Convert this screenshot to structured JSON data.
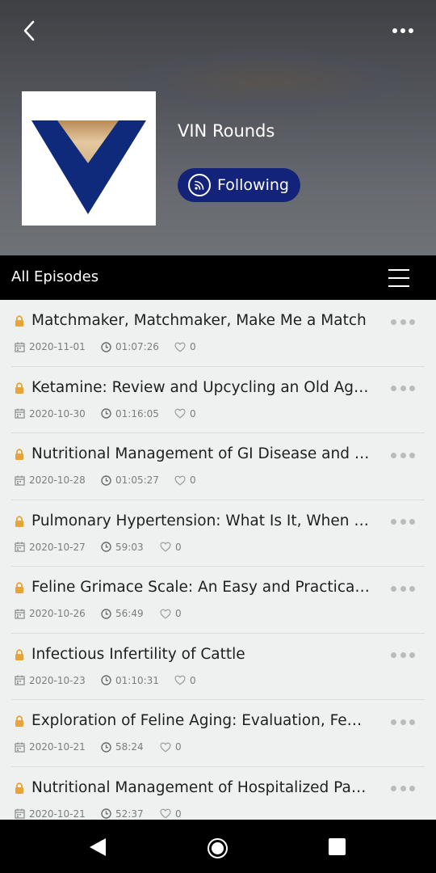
{
  "header": {
    "podcast_title": "VIN Rounds",
    "follow_label": "Following"
  },
  "section": {
    "title": "All Episodes"
  },
  "episodes": [
    {
      "title": "Matchmaker, Matchmaker, Make Me a Match",
      "date": "2020-11-01",
      "duration": "01:07:26",
      "likes": "0"
    },
    {
      "title": "Ketamine: Review and Upcycling an Old Agent",
      "date": "2020-10-30",
      "duration": "01:16:05",
      "likes": "0"
    },
    {
      "title": "Nutritional Management of GI Disease and More",
      "date": "2020-10-28",
      "duration": "01:05:27",
      "likes": "0"
    },
    {
      "title": "Pulmonary Hypertension: What Is It, When Should",
      "date": "2020-10-27",
      "duration": "59:03",
      "likes": "0"
    },
    {
      "title": "Feline Grimace Scale: An Easy and Practical Tool",
      "date": "2020-10-26",
      "duration": "56:49",
      "likes": "0"
    },
    {
      "title": "Infectious Infertility of Cattle",
      "date": "2020-10-23",
      "duration": "01:10:31",
      "likes": "0"
    },
    {
      "title": "Exploration of Feline Aging: Evaluation, Feeding",
      "date": "2020-10-21",
      "duration": "58:24",
      "likes": "0"
    },
    {
      "title": "Nutritional Management of Hospitalized Patients",
      "date": "2020-10-21",
      "duration": "52:37",
      "likes": "0"
    }
  ],
  "colors": {
    "follow_button": "#14237a",
    "lock_icon": "#e8a33a",
    "logo_blue": "#0f2a7a",
    "logo_gold": "#c9a273"
  }
}
